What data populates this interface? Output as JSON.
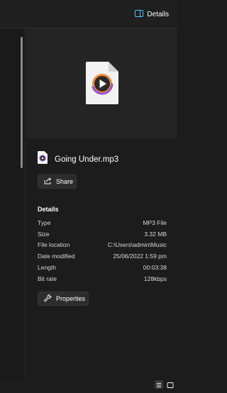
{
  "toolbar": {
    "details_label": "Details"
  },
  "file": {
    "name": "Going Under.mp3"
  },
  "actions": {
    "share_label": "Share",
    "properties_label": "Properties"
  },
  "details": {
    "title": "Details",
    "rows": [
      {
        "label": "Type",
        "value": "MP3 File"
      },
      {
        "label": "Size",
        "value": "3.32 MB"
      },
      {
        "label": "File location",
        "value": "C:\\Users\\admin\\Music"
      },
      {
        "label": "Date modified",
        "value": "25/06/2022 1:59 pm"
      },
      {
        "label": "Length",
        "value": "00:03:38"
      },
      {
        "label": "Bit rate",
        "value": "128kbps"
      }
    ]
  },
  "colors": {
    "accent": "#4cc2ff",
    "media_purple": "#9b4fd6",
    "media_orange": "#f28b3c"
  }
}
